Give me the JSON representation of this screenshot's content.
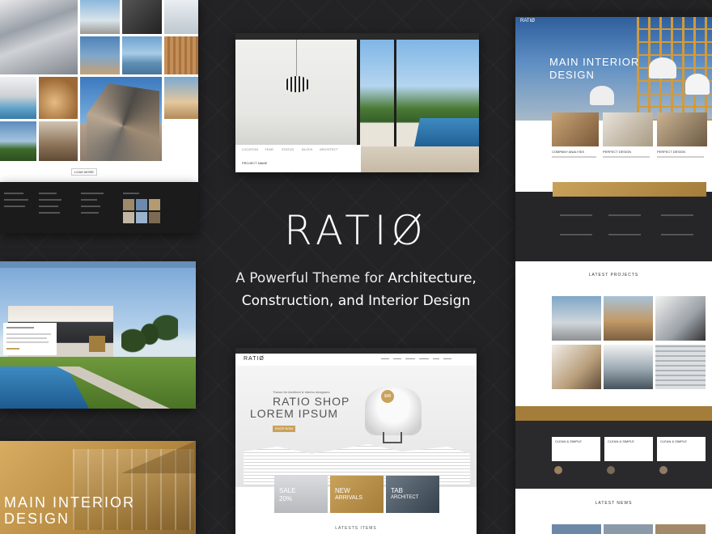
{
  "hero": {
    "logo": "RATIØ",
    "tagline_line1_plain": "A Powerful Theme for ",
    "tagline_line1_bold": "Architecture,",
    "tagline_line2": "Construction, and Interior Design"
  },
  "left_top": {
    "button": "LOAD MORE"
  },
  "left_bottom": {
    "title_line1": "MAIN INTERIOR",
    "title_line2": "DESIGN"
  },
  "center_top": {
    "meta_labels": [
      "LOCATION",
      "YEAR",
      "STATUS",
      "BLOCK",
      "ARCHITECT"
    ],
    "section_title": "PROJECT NAME"
  },
  "center_bottom": {
    "logo": "RATIØ",
    "subtitle": "Theme for Architect & Interior designers",
    "title_line1": "RATIO SHOP",
    "title_line2": "LOREM IPSUM",
    "price_badge": "$48",
    "button": "SHOP NOW",
    "promo1_line1": "SALE",
    "promo1_line2": "20%",
    "promo2_line1": "NEW",
    "promo2_line2": "ARRIVALS",
    "promo3_line1": "TAB",
    "promo3_line2": "ARCHITECT",
    "latest": "LATESTS ITEMS"
  },
  "right_col": {
    "logo": "RATIØ",
    "hero_line1": "MAIN INTERIOR",
    "hero_line2": "DESIGN",
    "services": [
      "COMPANY ANALYSIS",
      "PERFECT DESIGN",
      "PERFECT DESIGN"
    ],
    "latest_projects": "LATEST PROJECTS",
    "testimonial_labels": [
      "CLEAN & SIMPLE",
      "CLEAN & SIMPLE",
      "CLEAN & SIMPLE"
    ],
    "latest_news": "LATEST NEWS"
  },
  "colors": {
    "background": "#202022",
    "accent_gold": "#c9a25b",
    "text_white": "#ffffff"
  }
}
